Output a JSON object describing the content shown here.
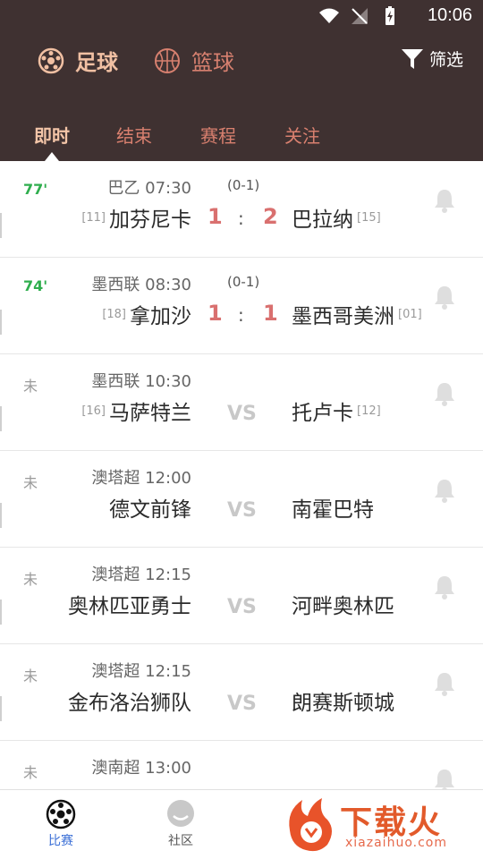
{
  "status_bar": {
    "time": "10:06"
  },
  "header": {
    "sports": [
      {
        "label": "足球",
        "icon": "soccer-ball-icon",
        "active": true
      },
      {
        "label": "篮球",
        "icon": "basketball-icon",
        "active": false
      }
    ],
    "filter_label": "筛选",
    "tabs": [
      {
        "label": "即时",
        "active": true
      },
      {
        "label": "结束",
        "active": false
      },
      {
        "label": "赛程",
        "active": false
      },
      {
        "label": "关注",
        "active": false
      }
    ]
  },
  "matches": [
    {
      "minute": "77'",
      "status": "live",
      "league": "巴乙",
      "time": "07:30",
      "halftime": "(0-1)",
      "home": "加芬尼卡",
      "home_rank": "[11]",
      "home_score": "1",
      "away": "巴拉纳",
      "away_rank": "[15]",
      "away_score": "2"
    },
    {
      "minute": "74'",
      "status": "live",
      "league": "墨西联",
      "time": "08:30",
      "halftime": "(0-1)",
      "home": "拿加沙",
      "home_rank": "[18]",
      "home_score": "1",
      "away": "墨西哥美洲",
      "away_rank": "[01]",
      "away_score": "1"
    },
    {
      "minute": "未",
      "status": "pending",
      "league": "墨西联",
      "time": "10:30",
      "home": "马萨特兰",
      "home_rank": "[16]",
      "away": "托卢卡",
      "away_rank": "[12]",
      "vs": "VS"
    },
    {
      "minute": "未",
      "status": "pending",
      "league": "澳塔超",
      "time": "12:00",
      "home": "德文前锋",
      "away": "南霍巴特",
      "vs": "VS"
    },
    {
      "minute": "未",
      "status": "pending",
      "league": "澳塔超",
      "time": "12:15",
      "home": "奥林匹亚勇士",
      "away": "河畔奥林匹",
      "vs": "VS"
    },
    {
      "minute": "未",
      "status": "pending",
      "league": "澳塔超",
      "time": "12:15",
      "home": "金布洛治狮队",
      "away": "朗赛斯顿城",
      "vs": "VS"
    },
    {
      "minute": "未",
      "status": "pending",
      "league": "澳南超",
      "time": "13:00",
      "home": "",
      "away": "",
      "vs": ""
    }
  ],
  "bottom_nav": [
    {
      "label": "比赛",
      "icon": "soccer-ball-icon",
      "active": true
    },
    {
      "label": "社区",
      "icon": "chat-bubble-icon",
      "active": false
    }
  ],
  "watermark": {
    "text": "下载火",
    "sub": "xiazaihuo.com"
  },
  "colors": {
    "header_bg": "#3f3131",
    "active_tab": "#f3c5a8",
    "inactive_tab": "#d9806f",
    "score": "#d9706f",
    "live_minute": "#2fae4e",
    "nav_active": "#3b6fd6"
  }
}
